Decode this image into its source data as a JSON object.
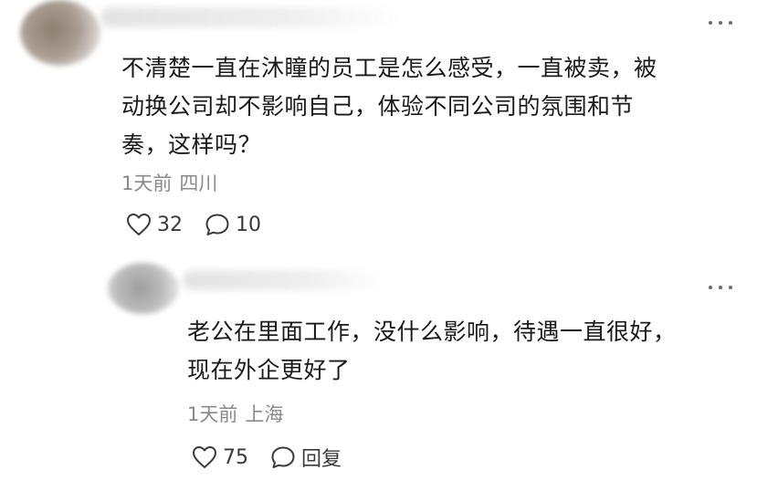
{
  "comments": [
    {
      "text_lines": [
        "不清楚一直在沐瞳的员工是怎么感受，一直被卖，被",
        "动换公司却不影响自己，体验不同公司的氛围和节",
        "奏，这样吗？"
      ],
      "time": "1天前",
      "location": "四川",
      "likes": "32",
      "replies": "10",
      "more_icon": "more-horizontal-icon",
      "like_icon": "heart-outline-icon",
      "reply_icon": "speech-bubble-icon"
    },
    {
      "text_lines": [
        "老公在里面工作，没什么影响，待遇一直很好，",
        "现在外企更好了"
      ],
      "time": "1天前",
      "location": "上海",
      "likes": "75",
      "reply_label": "回复",
      "more_icon": "more-horizontal-icon",
      "like_icon": "heart-outline-icon",
      "reply_icon": "speech-bubble-icon"
    }
  ],
  "colors": {
    "text": "#1a1a1a",
    "meta": "#8a8a8a",
    "icon": "#3a3a3a"
  }
}
